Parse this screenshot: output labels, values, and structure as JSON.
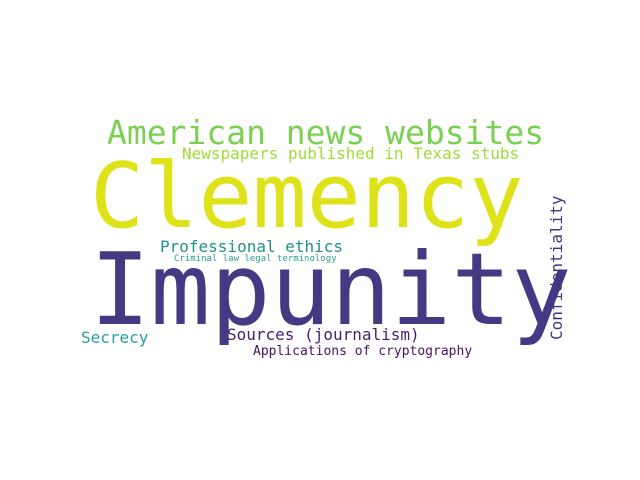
{
  "words": {
    "american_news_websites": {
      "text": "American news websites",
      "color": "#7ad151"
    },
    "newspapers_texas": {
      "text": "Newspapers published in Texas stubs",
      "color": "#a0da39"
    },
    "clemency": {
      "text": "Clemency",
      "color": "#dde318"
    },
    "impunity": {
      "text": "Impunity",
      "color": "#443983"
    },
    "professional_ethics": {
      "text": "Professional ethics",
      "color": "#21918c"
    },
    "criminal_law": {
      "text": "Criminal law legal terminology",
      "color": "#2a9d8f"
    },
    "confidentiality": {
      "text": "Confidentiality",
      "color": "#46327e"
    },
    "secrecy": {
      "text": "Secrecy",
      "color": "#2a9d9e"
    },
    "sources_journalism": {
      "text": "Sources (journalism)",
      "color": "#482173"
    },
    "applications_cryptography": {
      "text": "Applications of cryptography",
      "color": "#471365"
    }
  }
}
